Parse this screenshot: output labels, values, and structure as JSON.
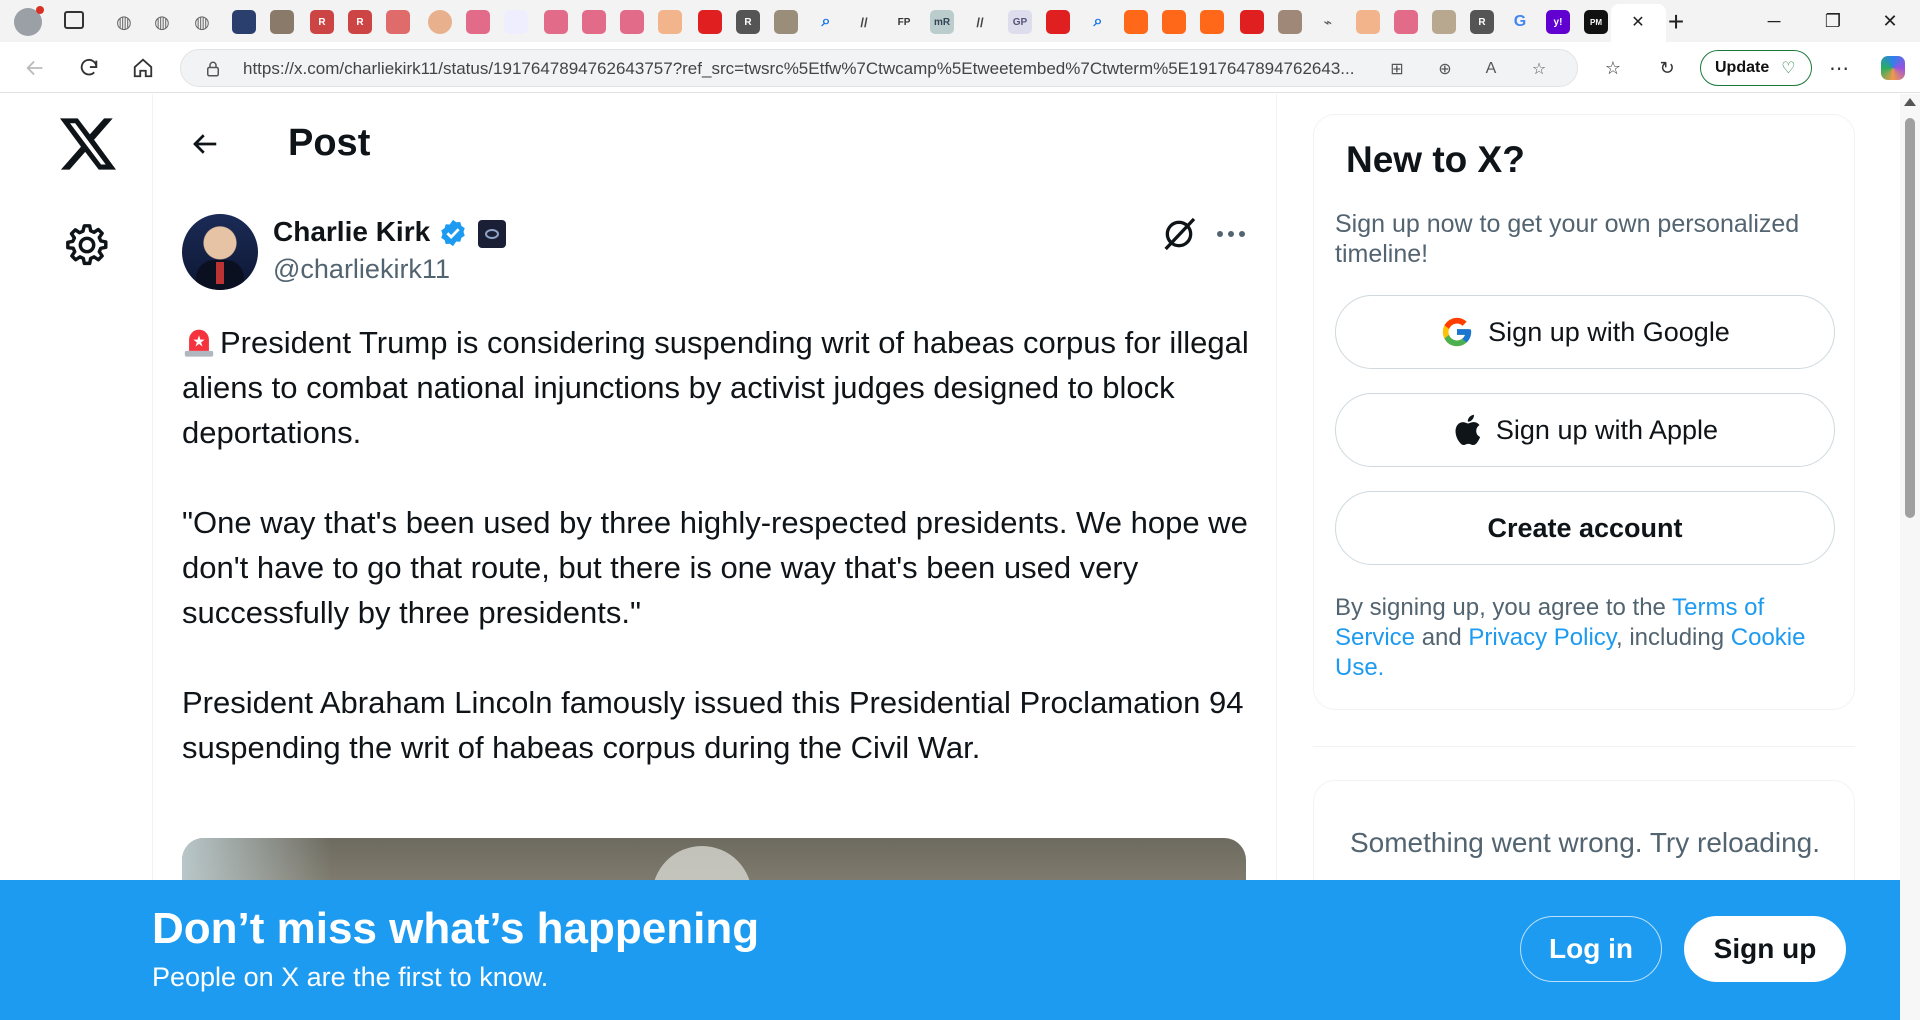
{
  "browser": {
    "url": "https://x.com/charliekirk11/status/1917647894762643757?ref_src=twsrc%5Etfw%7Ctwcamp%5Etweetembed%7Ctwterm%5E1917647894762643...",
    "update_label": "Update",
    "tab_close": "✕",
    "new_tab": "+"
  },
  "header": {
    "title": "Post"
  },
  "post": {
    "author_name": "Charlie Kirk",
    "handle": "@charliekirk11",
    "paragraph_1": "President Trump is considering suspending writ of habeas corpus for illegal aliens to combat national injunctions by activist judges designed to block deportations.",
    "paragraph_2": "\"One way that's been used by three highly-respected presidents. We hope we don't have to go that route, but there is one way that's been used very successfully by three presidents.\"",
    "paragraph_3": "President Abraham Lincoln famously issued this Presidential Proclamation 94 suspending the writ of habeas corpus during the Civil War."
  },
  "sidebar": {
    "title": "New to X?",
    "subtitle": "Sign up now to get your own personalized timeline!",
    "google_label": "Sign up with Google",
    "apple_label": "Sign up with Apple",
    "create_label": "Create account",
    "terms_prefix": "By signing up, you agree to the ",
    "terms_link": "Terms of Service",
    "terms_and": " and ",
    "privacy_link": "Privacy Policy",
    "terms_including": ", including ",
    "cookie_link": "Cookie Use.",
    "error_text": "Something went wrong. Try reloading."
  },
  "banner": {
    "title": "Don’t miss what’s happening",
    "subtitle": "People on X are the first to know.",
    "login_label": "Log in",
    "signup_label": "Sign up"
  },
  "colors": {
    "accent": "#1d9bf0",
    "text_primary": "#0f1419",
    "text_secondary": "#536471"
  },
  "icons": {
    "logo": "x-logo-icon",
    "settings": "gear-icon",
    "back": "arrow-left-icon",
    "verified": "verified-badge-icon",
    "grok": "grok-icon",
    "more": "more-dots-icon",
    "siren": "siren-emoji-icon",
    "google": "google-icon",
    "apple": "apple-icon"
  }
}
